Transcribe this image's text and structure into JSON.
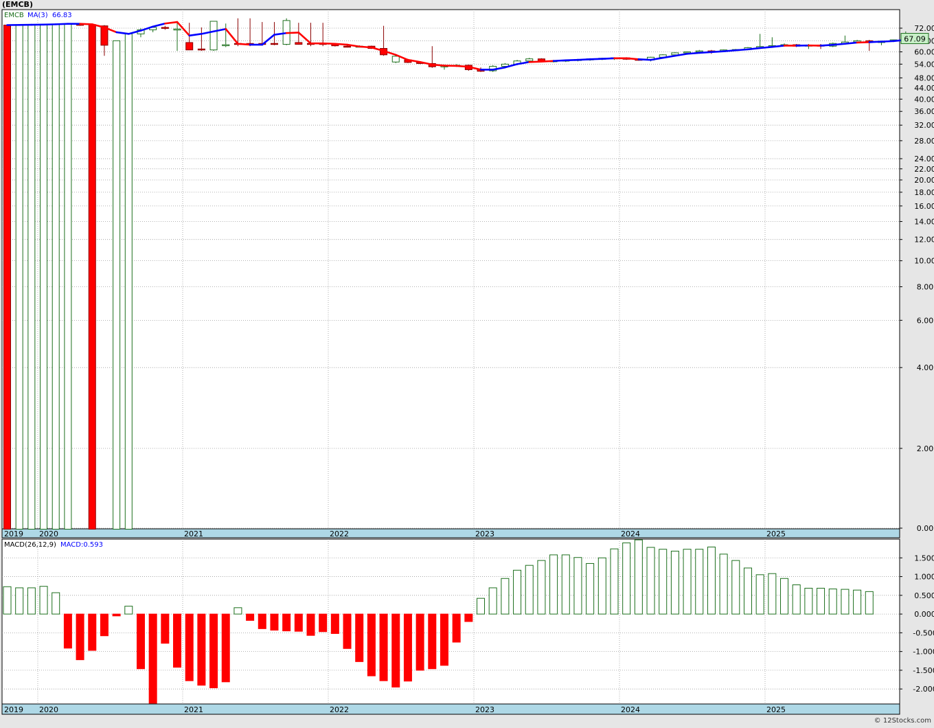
{
  "header": {
    "title": "(EMCB)"
  },
  "watermark": "© 12Stocks.com",
  "colors": {
    "up": "#1b6e1b",
    "down": "#ff0000",
    "ma_up": "#0000ff",
    "ma_down": "#ff0000",
    "axis_band": "#aed8e6",
    "price_badge": "#c8f0c8"
  },
  "chart_data": [
    {
      "type": "candlestick",
      "panel": "price",
      "legend": {
        "symbol": "EMCB",
        "ma_label": "MA(3)",
        "ma_value": "66.83"
      },
      "current_price": "67.09",
      "y_scale": "log",
      "y_ticks": [
        "72.00",
        "66.00",
        "60.00",
        "54.00",
        "48.00",
        "44.00",
        "40.00",
        "36.00",
        "32.00",
        "28.00",
        "24.00",
        "22.00",
        "20.00",
        "18.00",
        "16.00",
        "14.00",
        "12.00",
        "10.00",
        "8.00",
        "6.00",
        "4.00",
        "2.00",
        "0.00"
      ],
      "x_labels": [
        "2019",
        "2020",
        "2021",
        "2022",
        "2023",
        "2024",
        "2025"
      ],
      "x_label_months": [
        5,
        9,
        21,
        33,
        45,
        57,
        69
      ],
      "start": "2019-05",
      "candles": [
        [
          75.5,
          75.5,
          0.3,
          0.3
        ],
        [
          0.3,
          75.5,
          0.3,
          75.5
        ],
        [
          0.3,
          75.5,
          0.3,
          75.5
        ],
        [
          0.3,
          75.5,
          0.3,
          75.5
        ],
        [
          0.3,
          76.2,
          0.3,
          76.0
        ],
        [
          0.3,
          76.3,
          0.3,
          76.0
        ],
        [
          76.0,
          76.5,
          75.0,
          75.8
        ],
        [
          75.8,
          76.0,
          0.3,
          0.3
        ],
        [
          75.0,
          75.5,
          58.0,
          63.5
        ],
        [
          0.3,
          66.0,
          0.3,
          66.0
        ],
        [
          0.3,
          70.0,
          0.3,
          70.0
        ],
        [
          70.0,
          73.5,
          68.0,
          72.5
        ],
        [
          72.5,
          75.0,
          71.0,
          74.0
        ],
        [
          74.0,
          75.0,
          72.5,
          73.5
        ],
        [
          73.0,
          77.0,
          60.5,
          73.0
        ],
        [
          65.0,
          77.0,
          61.0,
          61.0
        ],
        [
          61.5,
          74.0,
          60.5,
          61.0
        ],
        [
          61.0,
          77.0,
          60.5,
          78.0
        ],
        [
          63.5,
          76.5,
          62.5,
          63.8
        ],
        [
          64.5,
          80.0,
          63.0,
          64.0
        ],
        [
          64.5,
          80.0,
          63.0,
          64.0
        ],
        [
          64.5,
          77.5,
          63.5,
          64.0
        ],
        [
          64.5,
          77.5,
          63.5,
          64.0
        ],
        [
          64.0,
          80.0,
          63.5,
          78.5
        ],
        [
          65.0,
          77.0,
          63.8,
          64.0
        ],
        [
          64.5,
          77.0,
          63.0,
          64.0
        ],
        [
          64.5,
          77.0,
          63.0,
          64.0
        ],
        [
          64.0,
          64.5,
          62.8,
          63.2
        ],
        [
          63.0,
          63.5,
          62.3,
          62.6
        ],
        [
          62.8,
          63.5,
          62.5,
          63.0
        ],
        [
          63.0,
          63.3,
          61.5,
          61.8
        ],
        [
          61.8,
          75.0,
          58.0,
          58.5
        ],
        [
          55.0,
          58.5,
          54.5,
          57.8
        ],
        [
          56.0,
          56.5,
          54.5,
          54.8
        ],
        [
          54.8,
          55.3,
          54.0,
          54.3
        ],
        [
          54.3,
          63.0,
          52.3,
          52.8
        ],
        [
          52.8,
          53.8,
          51.5,
          53.2
        ],
        [
          53.2,
          54.0,
          52.8,
          53.5
        ],
        [
          53.5,
          53.8,
          51.0,
          51.5
        ],
        [
          51.5,
          52.5,
          50.5,
          50.8
        ],
        [
          51.0,
          53.5,
          50.5,
          53.0
        ],
        [
          53.0,
          54.5,
          52.8,
          54.0
        ],
        [
          54.0,
          56.0,
          53.5,
          55.5
        ],
        [
          55.5,
          57.0,
          55.0,
          56.5
        ],
        [
          56.5,
          56.8,
          55.0,
          55.3
        ],
        [
          55.3,
          56.0,
          54.8,
          55.6
        ],
        [
          55.6,
          56.2,
          55.0,
          55.9
        ],
        [
          55.9,
          56.5,
          55.3,
          56.2
        ],
        [
          56.2,
          56.8,
          55.6,
          56.5
        ],
        [
          56.5,
          57.0,
          55.9,
          56.8
        ],
        [
          56.8,
          57.3,
          56.0,
          57.0
        ],
        [
          57.0,
          57.3,
          56.0,
          56.3
        ],
        [
          56.3,
          56.8,
          55.6,
          55.9
        ],
        [
          55.9,
          57.5,
          55.3,
          57.3
        ],
        [
          57.3,
          58.8,
          57.0,
          58.5
        ],
        [
          58.5,
          59.8,
          58.2,
          59.5
        ],
        [
          59.5,
          60.2,
          59.0,
          60.0
        ],
        [
          60.0,
          61.0,
          59.5,
          60.5
        ],
        [
          60.5,
          61.0,
          59.0,
          60.2
        ],
        [
          60.2,
          61.2,
          60.0,
          61.0
        ],
        [
          61.0,
          61.5,
          60.5,
          61.2
        ],
        [
          61.2,
          62.5,
          61.0,
          62.2
        ],
        [
          62.2,
          70.0,
          62.0,
          62.8
        ],
        [
          62.8,
          68.0,
          62.5,
          63.3
        ],
        [
          63.3,
          64.5,
          62.8,
          63.8
        ],
        [
          63.8,
          64.2,
          62.5,
          63.0
        ],
        [
          63.0,
          64.2,
          61.5,
          63.6
        ],
        [
          63.6,
          64.2,
          61.5,
          63.0
        ],
        [
          63.0,
          65.0,
          62.5,
          64.5
        ],
        [
          64.5,
          69.0,
          63.8,
          65.3
        ],
        [
          65.3,
          66.5,
          64.8,
          66.0
        ],
        [
          66.0,
          66.5,
          60.5,
          65.0
        ],
        [
          65.0,
          66.0,
          63.5,
          65.8
        ],
        [
          65.8,
          66.5,
          65.3,
          66.5
        ],
        [
          66.5,
          71.5,
          66.0,
          67.0
        ],
        [
          67.0,
          68.0,
          66.3,
          67.09
        ]
      ],
      "ma3": [
        75.5,
        75.6,
        75.7,
        75.8,
        76.0,
        76.3,
        76.3,
        76.0,
        74.0,
        71.0,
        70.0,
        72.0,
        74.5,
        76.5,
        77.5,
        69.0,
        70.0,
        71.5,
        73.0,
        64.3,
        63.8,
        63.8,
        69.5,
        70.5,
        70.8,
        64.5,
        64.5,
        64.3,
        63.8,
        62.8,
        62.3,
        60.5,
        58.5,
        56.0,
        55.0,
        53.8,
        53.3,
        53.2,
        52.8,
        51.5,
        51.5,
        52.5,
        54.0,
        55.0,
        55.2,
        55.5,
        55.8,
        56.0,
        56.3,
        56.5,
        56.8,
        56.8,
        56.3,
        56.0,
        57.0,
        58.0,
        59.0,
        59.5,
        59.9,
        60.3,
        60.8,
        61.3,
        62.0,
        62.6,
        63.3,
        63.3,
        63.4,
        63.3,
        63.7,
        64.3,
        65.0,
        65.2,
        65.5,
        65.8,
        66.5,
        66.83
      ],
      "ma_direction": [
        "up",
        "up",
        "up",
        "up",
        "up",
        "up",
        "up",
        "down",
        "down",
        "down",
        "up",
        "up",
        "up",
        "up",
        "down",
        "down",
        "up",
        "up",
        "up",
        "down",
        "down",
        "up",
        "up",
        "up",
        "down",
        "down",
        "down",
        "down",
        "down",
        "down",
        "down",
        "down",
        "down",
        "down",
        "down",
        "down",
        "down",
        "down",
        "down",
        "down",
        "up",
        "up",
        "up",
        "up",
        "down",
        "down",
        "up",
        "up",
        "up",
        "up",
        "up",
        "down",
        "down",
        "up",
        "up",
        "up",
        "up",
        "up",
        "up",
        "up",
        "up",
        "up",
        "up",
        "up",
        "up",
        "down",
        "up",
        "down",
        "up",
        "up",
        "up",
        "down",
        "up",
        "up",
        "up",
        "up"
      ]
    },
    {
      "type": "bar",
      "panel": "macd",
      "legend": {
        "label": "MACD(26,12,9)",
        "value_label": "MACD:0.593"
      },
      "y_ticks": [
        "1.500",
        "1.000",
        "0.500",
        "0.000",
        "-0.500",
        "-1.000",
        "-1.500",
        "-2.000"
      ],
      "ylim": [
        -2.4,
        2.0
      ],
      "x_labels": [
        "2019",
        "2020",
        "2021",
        "2022",
        "2023",
        "2024",
        "2025"
      ],
      "values": [
        0.73,
        0.7,
        0.7,
        0.74,
        0.57,
        -0.91,
        -1.22,
        -0.97,
        -0.58,
        -0.05,
        0.21,
        -1.46,
        -2.38,
        -0.78,
        -1.42,
        -1.78,
        -1.9,
        -1.97,
        -1.81,
        0.17,
        -0.17,
        -0.39,
        -0.43,
        -0.45,
        -0.46,
        -0.57,
        -0.47,
        -0.52,
        -0.92,
        -1.27,
        -1.65,
        -1.78,
        -1.95,
        -1.79,
        -1.5,
        -1.46,
        -1.37,
        -0.75,
        -0.2,
        0.42,
        0.7,
        0.95,
        1.17,
        1.3,
        1.43,
        1.58,
        1.58,
        1.51,
        1.35,
        1.5,
        1.74,
        1.9,
        1.98,
        1.78,
        1.73,
        1.68,
        1.73,
        1.73,
        1.79,
        1.6,
        1.43,
        1.23,
        1.05,
        1.08,
        0.95,
        0.78,
        0.69,
        0.69,
        0.67,
        0.66,
        0.64,
        0.6
      ]
    }
  ]
}
